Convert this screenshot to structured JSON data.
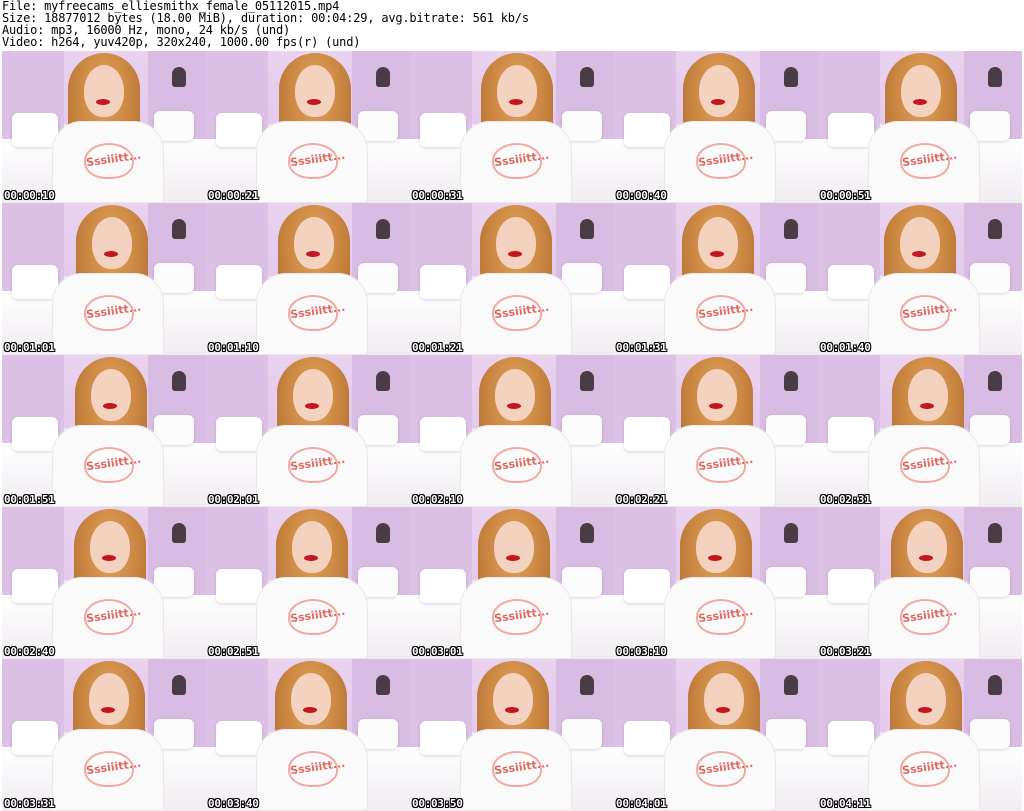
{
  "header": {
    "file_line": "File: myfreecams_elliesmithx_female_05112015.mp4",
    "size_line": "Size: 18877012 bytes (18.00 MiB), duration: 00:04:29, avg.bitrate: 561 kb/s",
    "audio_line": "Audio: mp3, 16000 Hz, mono, 24 kb/s (und)",
    "video_line": "Video: h264, yuv420p, 320x240, 1000.00 fps(r) (und)"
  },
  "frames": [
    {
      "timestamp": "00:00:10",
      "shirt_text": "Sssiiitt..."
    },
    {
      "timestamp": "00:00:21",
      "shirt_text": "Sssiiitt..."
    },
    {
      "timestamp": "00:00:31",
      "shirt_text": "Sssiiitt..."
    },
    {
      "timestamp": "00:00:40",
      "shirt_text": "Sssiiitt..."
    },
    {
      "timestamp": "00:00:51",
      "shirt_text": "Sssiiitt..."
    },
    {
      "timestamp": "00:01:01",
      "shirt_text": "Sssiiitt..."
    },
    {
      "timestamp": "00:01:10",
      "shirt_text": "Sssiiitt..."
    },
    {
      "timestamp": "00:01:21",
      "shirt_text": "Sssiiitt..."
    },
    {
      "timestamp": "00:01:31",
      "shirt_text": "Sssiiitt..."
    },
    {
      "timestamp": "00:01:40",
      "shirt_text": "Sssiiitt..."
    },
    {
      "timestamp": "00:01:51",
      "shirt_text": "Sssiiitt..."
    },
    {
      "timestamp": "00:02:01",
      "shirt_text": "Sssiiitt..."
    },
    {
      "timestamp": "00:02:10",
      "shirt_text": "Sssiiitt..."
    },
    {
      "timestamp": "00:02:21",
      "shirt_text": "Sssiiitt..."
    },
    {
      "timestamp": "00:02:31",
      "shirt_text": "Sssiiitt..."
    },
    {
      "timestamp": "00:02:40",
      "shirt_text": "Sssiiitt..."
    },
    {
      "timestamp": "00:02:51",
      "shirt_text": "Sssiiitt..."
    },
    {
      "timestamp": "00:03:01",
      "shirt_text": "Sssiiitt..."
    },
    {
      "timestamp": "00:03:10",
      "shirt_text": "Sssiiitt..."
    },
    {
      "timestamp": "00:03:21",
      "shirt_text": "Sssiiitt..."
    },
    {
      "timestamp": "00:03:31",
      "shirt_text": "Sssiiitt..."
    },
    {
      "timestamp": "00:03:40",
      "shirt_text": "Sssiiitt..."
    },
    {
      "timestamp": "00:03:50",
      "shirt_text": "Sssiiitt..."
    },
    {
      "timestamp": "00:04:01",
      "shirt_text": "Sssiiitt..."
    },
    {
      "timestamp": "00:04:11",
      "shirt_text": "Sssiiitt..."
    }
  ]
}
